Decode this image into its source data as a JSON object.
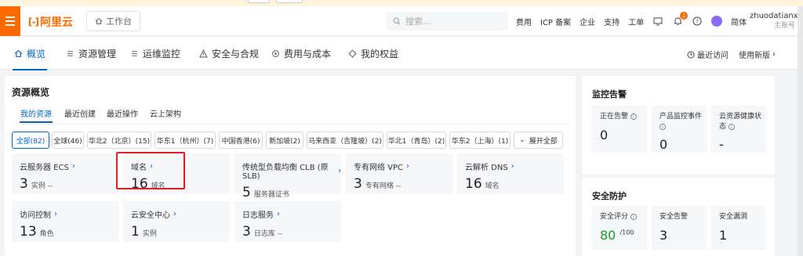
{
  "topbar": {
    "logo_text": "阿里云",
    "logo_mark": "[-]",
    "workbench_label": "工作台",
    "search_placeholder": "搜索...",
    "nav_links": [
      "费用",
      "ICP 备案",
      "企业",
      "支持",
      "工单"
    ],
    "notification_count": "1",
    "language": "简体",
    "username": "zhuodatianxi...",
    "user_role": "主账号"
  },
  "tabs": [
    {
      "label": "概览",
      "icon": "home-icon"
    },
    {
      "label": "资源管理",
      "icon": "list-icon"
    },
    {
      "label": "运维监控",
      "icon": "list-icon"
    },
    {
      "label": "安全与合规",
      "icon": "warning-icon"
    },
    {
      "label": "费用与成本",
      "icon": "gear-icon"
    },
    {
      "label": "我的权益",
      "icon": "diamond-icon"
    }
  ],
  "tabbar_right": {
    "recent_visits": "最近访问",
    "use_new_version": "使用新版"
  },
  "resource_overview": {
    "title": "资源概览",
    "subtabs": [
      "我的资源",
      "最近创建",
      "最近操作",
      "云上架构"
    ],
    "region_filters": [
      "全部(82)",
      "全球(46)",
      "华北2（北京）(15)",
      "华东1（杭州）(7)",
      "中国香港(6)",
      "新加坡(2)",
      "马来西亚（吉隆坡）(2)",
      "华北1（青岛）(2)",
      "华东2（上海）(1)"
    ],
    "expand_all": "展开全部",
    "cards": [
      {
        "label": "云服务器 ECS",
        "value": "3",
        "unit": "实例 --"
      },
      {
        "label": "域名",
        "value": "16",
        "unit": "域名"
      },
      {
        "label": "传统型负载均衡 CLB (原SLB)",
        "value": "5",
        "unit": "服务器证书"
      },
      {
        "label": "专有网络 VPC",
        "value": "3",
        "unit": "专有网络 --"
      },
      {
        "label": "云解析 DNS",
        "value": "16",
        "unit": "域名"
      },
      {
        "label": "访问控制",
        "value": "13",
        "unit": "角色"
      },
      {
        "label": "云安全中心",
        "value": "1",
        "unit": "实例"
      },
      {
        "label": "日志服务",
        "value": "3",
        "unit": "日志库 --"
      }
    ]
  },
  "monitoring": {
    "title": "监控告警",
    "items": [
      {
        "label": "正在告警",
        "value": "0"
      },
      {
        "label": "产品监控事件",
        "value": "0"
      },
      {
        "label": "云资源健康状态",
        "value": "-"
      }
    ]
  },
  "security": {
    "title": "安全防护",
    "items": [
      {
        "label": "安全评分",
        "value": "80",
        "suffix": "/100"
      },
      {
        "label": "安全告警",
        "value": "3"
      },
      {
        "label": "安全漏洞",
        "value": "1"
      }
    ]
  },
  "colors": {
    "brand": "#ff6a00",
    "accent": "#0064c8",
    "highlight": "#e02020",
    "score_green": "#1a9a2c"
  }
}
